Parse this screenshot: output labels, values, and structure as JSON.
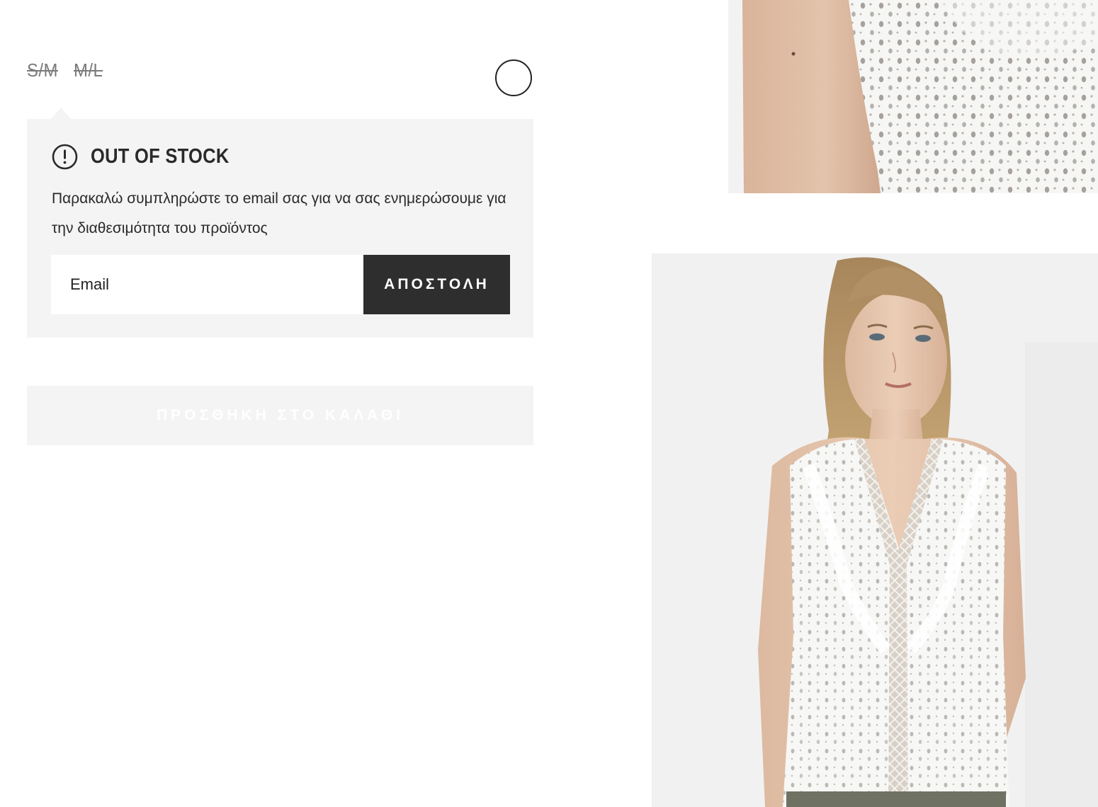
{
  "size_selector": {
    "options": [
      {
        "label": "S/M",
        "available": false
      },
      {
        "label": "M/L",
        "available": false
      }
    ]
  },
  "color_swatch": {
    "color": "#ffffff"
  },
  "out_of_stock": {
    "icon": "alert-circle-icon",
    "title": "OUT OF STOCK",
    "message": "Παρακαλώ συμπληρώστε το email σας για να σας ενημερώσουμε για την διαθεσιμότητα του προϊόντος",
    "email_placeholder": "Email",
    "email_value": "",
    "send_label": "ΑΠΟΣΤΟΛΗ"
  },
  "cart": {
    "add_to_cart_label": "ΠΡΟΣΘΗΚΗ ΣΤΟ ΚΑΛΑΘΙ",
    "enabled": false
  },
  "colors": {
    "panel_background": "#f4f4f4",
    "button_dark": "#2e2e2e",
    "text_primary": "#2a2a2a",
    "size_disabled": "#7a7a7a"
  }
}
